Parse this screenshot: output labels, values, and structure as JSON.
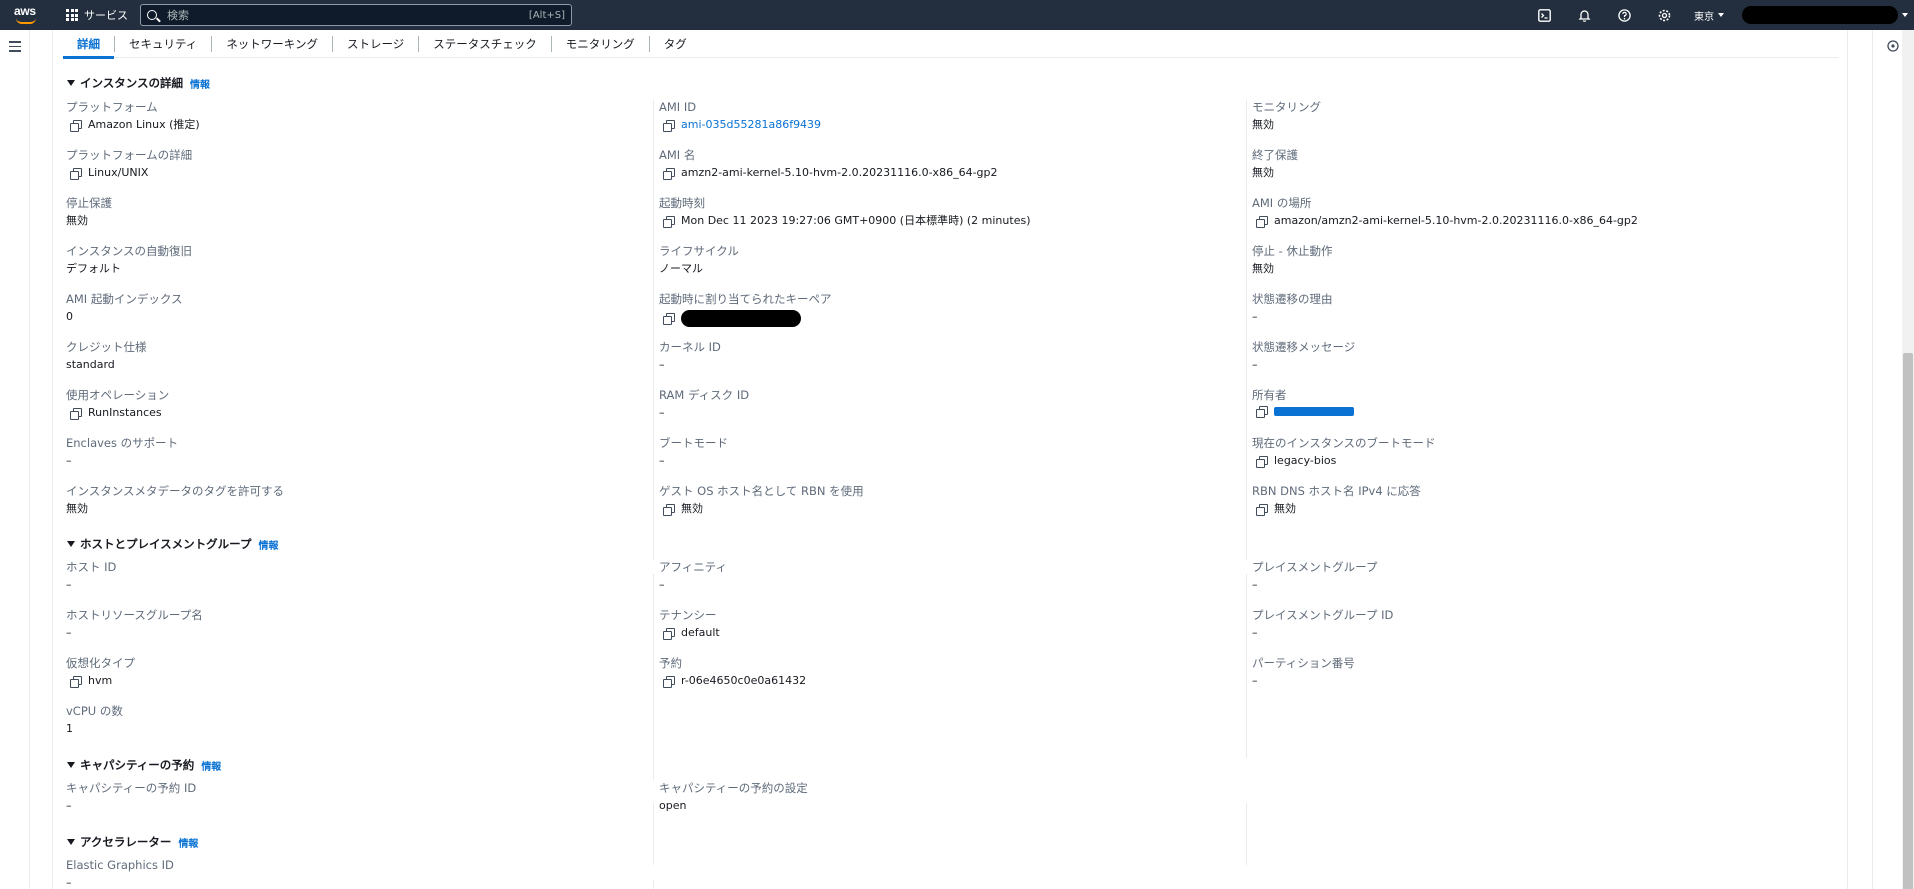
{
  "nav": {
    "services_label": "サービス",
    "search_placeholder": "検索",
    "search_shortcut": "[Alt+S]",
    "region": "東京"
  },
  "tabs": [
    "詳細",
    "セキュリティ",
    "ネットワーキング",
    "ストレージ",
    "ステータスチェック",
    "モニタリング",
    "タグ"
  ],
  "sections": {
    "instance_details": {
      "title": "インスタンスの詳細",
      "info": "情報"
    },
    "host_placement": {
      "title": "ホストとプレイスメントグループ",
      "info": "情報"
    },
    "capacity": {
      "title": "キャパシティーの予約",
      "info": "情報"
    },
    "accelerator": {
      "title": "アクセラレーター",
      "info": "情報"
    }
  },
  "fields": {
    "platform": {
      "label": "プラットフォーム",
      "value": "Amazon Linux (推定)"
    },
    "ami_id": {
      "label": "AMI ID",
      "value": "ami-035d55281a86f9439"
    },
    "monitoring": {
      "label": "モニタリング",
      "value": "無効"
    },
    "platform_details": {
      "label": "プラットフォームの詳細",
      "value": "Linux/UNIX"
    },
    "ami_name": {
      "label": "AMI 名",
      "value": "amzn2-ami-kernel-5.10-hvm-2.0.20231116.0-x86_64-gp2"
    },
    "termination_protection": {
      "label": "終了保護",
      "value": "無効"
    },
    "stop_protection": {
      "label": "停止保護",
      "value": "無効"
    },
    "launch_time": {
      "label": "起動時刻",
      "value": "Mon Dec 11 2023 19:27:06 GMT+0900 (日本標準時) (2 minutes)"
    },
    "ami_location": {
      "label": "AMI の場所",
      "value": "amazon/amzn2-ami-kernel-5.10-hvm-2.0.20231116.0-x86_64-gp2"
    },
    "auto_recovery": {
      "label": "インスタンスの自動復旧",
      "value": "デフォルト"
    },
    "lifecycle": {
      "label": "ライフサイクル",
      "value": "ノーマル"
    },
    "stop_hibernate": {
      "label": "停止 - 休止動作",
      "value": "無効"
    },
    "ami_launch_index": {
      "label": "AMI 起動インデックス",
      "value": "0"
    },
    "key_pair": {
      "label": "起動時に割り当てられたキーペア",
      "value": ""
    },
    "state_reason": {
      "label": "状態遷移の理由",
      "value": "–"
    },
    "credit_spec": {
      "label": "クレジット仕様",
      "value": "standard"
    },
    "kernel_id": {
      "label": "カーネル ID",
      "value": "–"
    },
    "state_message": {
      "label": "状態遷移メッセージ",
      "value": "–"
    },
    "usage_operation": {
      "label": "使用オペレーション",
      "value": "RunInstances"
    },
    "ram_disk_id": {
      "label": "RAM ディスク ID",
      "value": "–"
    },
    "owner": {
      "label": "所有者",
      "value": ""
    },
    "enclaves": {
      "label": "Enclaves のサポート",
      "value": "–"
    },
    "boot_mode": {
      "label": "ブートモード",
      "value": "–"
    },
    "current_boot_mode": {
      "label": "現在のインスタンスのブートモード",
      "value": "legacy-bios"
    },
    "metadata_tags": {
      "label": "インスタンスメタデータのタグを許可する",
      "value": "無効"
    },
    "guest_os_rbn": {
      "label": "ゲスト OS ホスト名として RBN を使用",
      "value": "無効"
    },
    "rbn_dns": {
      "label": "RBN DNS ホスト名 IPv4 に応答",
      "value": "無効"
    },
    "host_id": {
      "label": "ホスト ID",
      "value": "–"
    },
    "affinity": {
      "label": "アフィニティ",
      "value": "–"
    },
    "placement_group": {
      "label": "プレイスメントグループ",
      "value": "–"
    },
    "host_resource_group": {
      "label": "ホストリソースグループ名",
      "value": "–"
    },
    "tenancy": {
      "label": "テナンシー",
      "value": "default"
    },
    "placement_group_id": {
      "label": "プレイスメントグループ ID",
      "value": "–"
    },
    "virtualization": {
      "label": "仮想化タイプ",
      "value": "hvm"
    },
    "reservation": {
      "label": "予約",
      "value": "r-06e4650c0e0a61432"
    },
    "partition_number": {
      "label": "パーティション番号",
      "value": "–"
    },
    "vcpu_count": {
      "label": "vCPU の数",
      "value": "1"
    },
    "capacity_reservation_id": {
      "label": "キャパシティーの予約 ID",
      "value": "–"
    },
    "capacity_reservation_setting": {
      "label": "キャパシティーの予約の設定",
      "value": "open"
    },
    "elastic_graphics_id": {
      "label": "Elastic Graphics ID",
      "value": "–"
    }
  }
}
